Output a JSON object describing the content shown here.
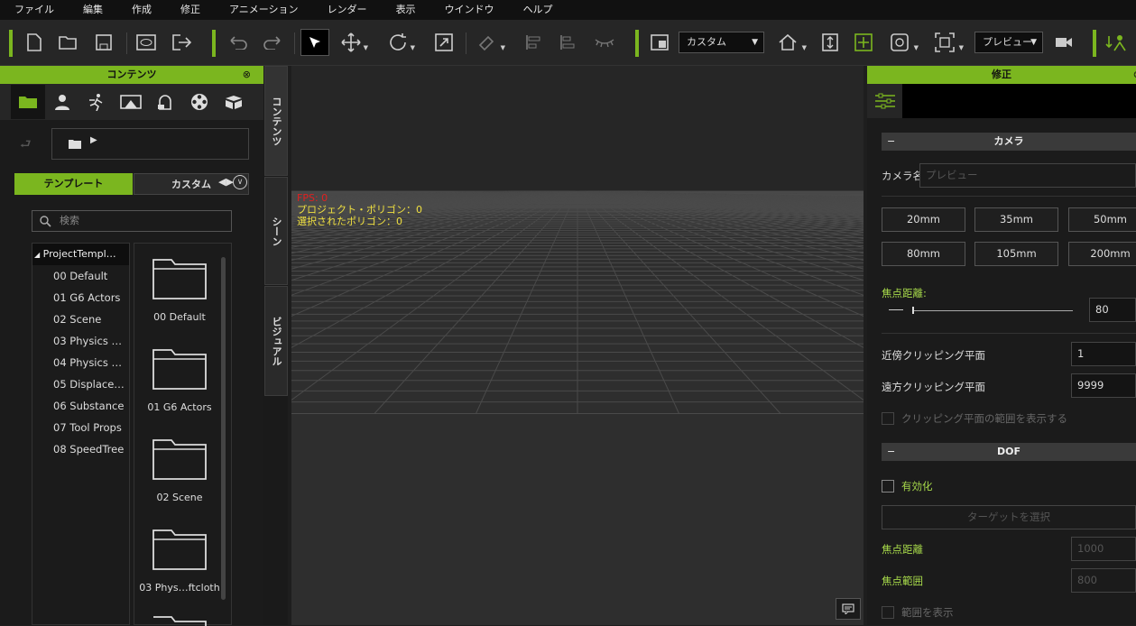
{
  "menubar": {
    "items": [
      "ファイル",
      "編集",
      "作成",
      "修正",
      "アニメーション",
      "レンダー",
      "表示",
      "ウインドウ",
      "ヘルプ"
    ]
  },
  "toolbar": {
    "icons": [
      "new-file-icon",
      "open-folder-icon",
      "save-icon",
      "preview-icon",
      "export-icon",
      "undo-icon",
      "redo-icon",
      "select-arrow-icon",
      "move-icon",
      "rotate-icon",
      "scale-icon",
      "pick-icon",
      "align-icon",
      "distribute-icon",
      "eye-lashes-icon",
      "layout-icon",
      "home-camera-icon",
      "fit-icon",
      "target-icon",
      "camera-3d-icon",
      "frame-icon",
      "video-camera-icon",
      "character-icon"
    ],
    "layout_dropdown": "カスタム",
    "camera_dropdown": "プレビュー"
  },
  "content_panel": {
    "title": "コンテンツ",
    "category_icons": [
      "folder-icon",
      "person-icon",
      "motion-icon",
      "stage-icon",
      "props-icon",
      "media-icon",
      "pack-icon"
    ],
    "tab_template": "テンプレート",
    "tab_custom": "カスタム",
    "search_placeholder": "検索",
    "tree_root": "ProjectTempl…",
    "tree_items": [
      "00 Default",
      "01 G6 Actors",
      "02 Scene",
      "03 Physics …",
      "04 Physics …",
      "05 Displace…",
      "06 Substance",
      "07 Tool Props",
      "08 SpeedTree"
    ],
    "grid_items": [
      "00 Default",
      "01 G6 Actors",
      "02 Scene",
      "03 Phys…ftcloth"
    ]
  },
  "side_tabs": {
    "content": "コンテンツ",
    "scene": "シーン",
    "visual": "ビジュアル"
  },
  "viewport": {
    "fps": "FPS: 0",
    "project_polygons": "プロジェクト・ポリゴン：0",
    "selected_polygons": "選択されたポリゴン：0"
  },
  "modify_panel": {
    "title": "修正",
    "camera_section": "カメラ",
    "camera_name_label": "カメラ名:",
    "camera_name_placeholder": "プレビュー",
    "lens_buttons": [
      "20mm",
      "35mm",
      "50mm",
      "80mm",
      "105mm",
      "200mm"
    ],
    "focal_length_label": "焦点距離:",
    "focal_length_value": "80",
    "near_clip_label": "近傍クリッピング平面",
    "near_clip_value": "1",
    "far_clip_label": "遠方クリッピング平面",
    "far_clip_value": "9999",
    "show_clip_label": "クリッピング平面の範囲を表示する",
    "dof_section": "DOF",
    "enable_label": "有効化",
    "select_target_label": "ターゲットを選択",
    "focus_distance_label": "焦点距離",
    "focus_distance_value": "1000",
    "focus_range_label": "焦点範囲",
    "focus_range_value": "800",
    "show_range_label": "範囲を表示"
  },
  "colors": {
    "accent": "#7bb61f",
    "panel": "#1b1b1b",
    "toolbar": "#262626",
    "fps_red": "#e02020",
    "stats_yellow": "#f0e040"
  }
}
